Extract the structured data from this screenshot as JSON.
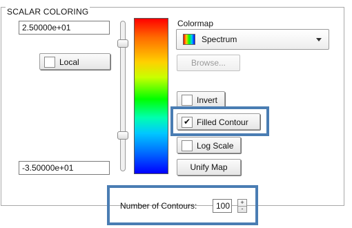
{
  "panel": {
    "title": "SCALAR COLORING"
  },
  "range": {
    "max": "2.50000e+01",
    "min": "-3.50000e+01"
  },
  "local": {
    "label": "Local",
    "checked": false
  },
  "colormap": {
    "label": "Colormap",
    "selected": "Spectrum",
    "browse_label": "Browse..."
  },
  "options": {
    "invert": {
      "label": "Invert",
      "checked": false
    },
    "filled_contour": {
      "label": "Filled Contour",
      "checked": true
    },
    "log_scale": {
      "label": "Log Scale",
      "checked": false
    }
  },
  "unify_map_label": "Unify Map",
  "contours": {
    "label": "Number of Contours:",
    "value": "100",
    "up": "+",
    "down": "-"
  },
  "colors": {
    "highlight": "#4a7db3",
    "colorbar_top": "#ff0000",
    "colorbar_bottom": "#0000ff"
  }
}
